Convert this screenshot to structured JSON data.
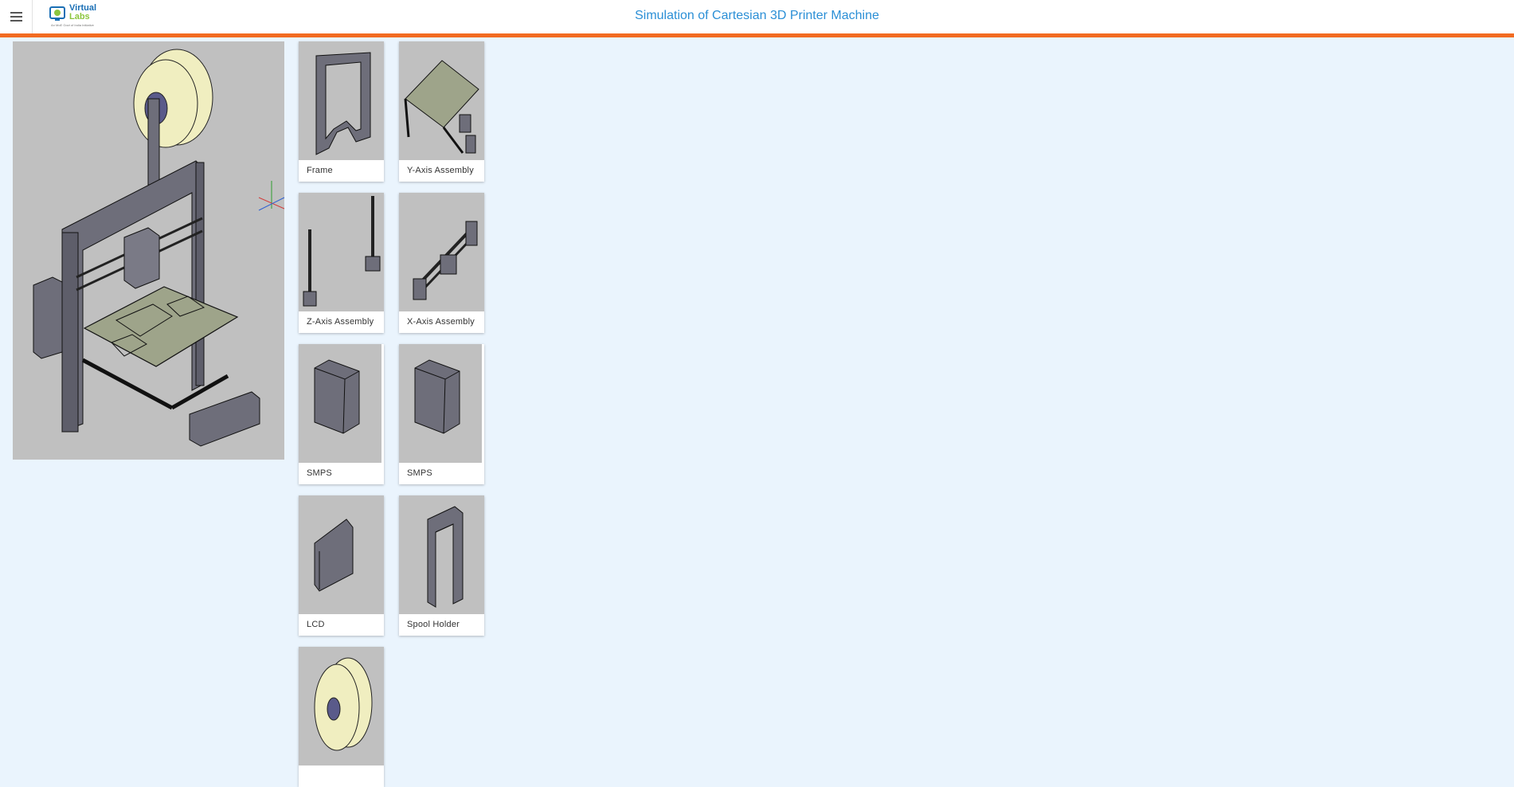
{
  "header": {
    "title": "Simulation of Cartesian 3D Printer Machine",
    "logo_line1": "Virtual",
    "logo_line2": "Labs",
    "logo_tagline": "An MoE Govt of India Initiative"
  },
  "icons": {
    "menu": "hamburger-icon",
    "axes": "axes-gizmo-icon"
  },
  "colors": {
    "accent": "#f26b21",
    "title": "#2b8fd6",
    "background": "#eaf4fd",
    "viewport": "#c0c0c0",
    "part_fill": "#6e6e7a",
    "bed": "#9ea48a",
    "spool": "#f0eec0"
  },
  "parts": [
    {
      "label": "Frame",
      "icon": "frame-part-icon"
    },
    {
      "label": "Y-Axis Assembly",
      "icon": "y-axis-assembly-icon"
    },
    {
      "label": "Z-Axis Assembly",
      "icon": "z-axis-assembly-icon"
    },
    {
      "label": "X-Axis Assembly",
      "icon": "x-axis-assembly-icon"
    },
    {
      "label": "SMPS",
      "icon": "smps-box-icon"
    },
    {
      "label": "SMPS",
      "icon": "smps-box-icon"
    },
    {
      "label": "LCD",
      "icon": "lcd-panel-icon"
    },
    {
      "label": "Spool Holder",
      "icon": "spool-holder-icon"
    },
    {
      "label": "",
      "icon": "spool-icon"
    }
  ]
}
